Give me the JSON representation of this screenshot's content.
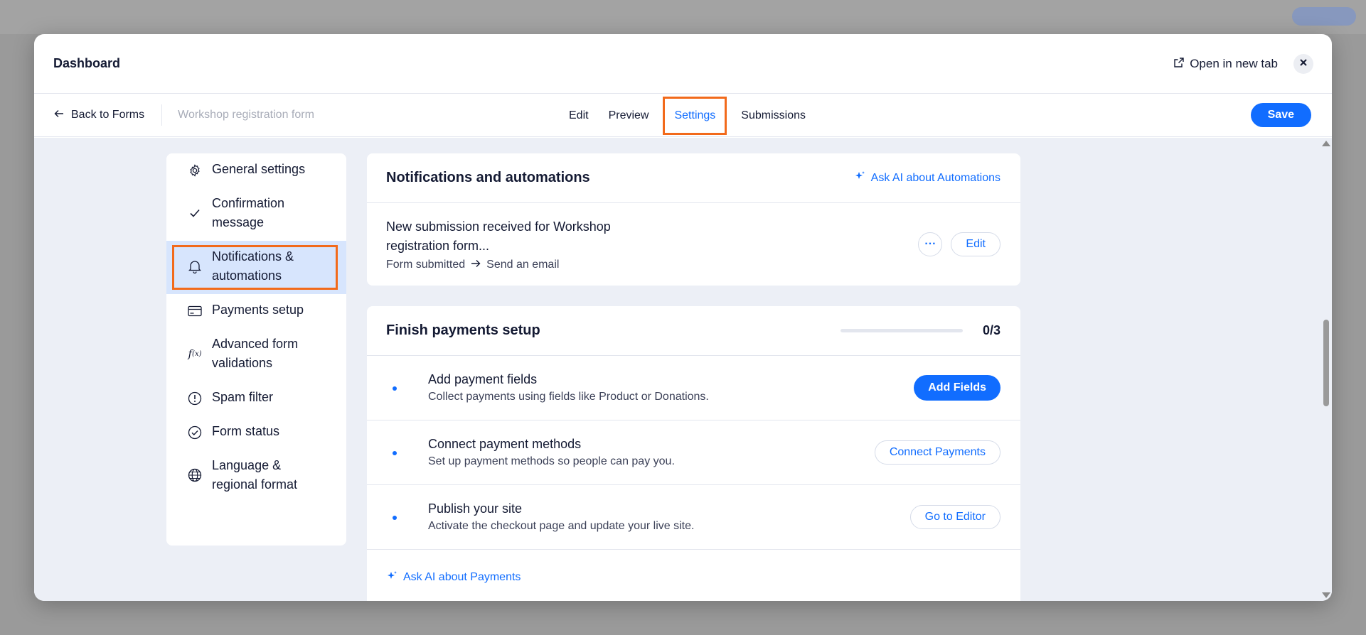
{
  "modal": {
    "title": "Dashboard",
    "open_new_tab": "Open in new tab"
  },
  "toolbar": {
    "back_label": "Back to Forms",
    "form_name": "Workshop registration form",
    "tabs": [
      "Edit",
      "Preview",
      "Settings",
      "Submissions"
    ],
    "active_tab": "Settings",
    "save_label": "Save"
  },
  "sidebar": {
    "items": [
      {
        "label": "General settings",
        "icon": "gear-icon"
      },
      {
        "label": "Confirmation message",
        "icon": "check-icon"
      },
      {
        "label": "Notifications & automations",
        "icon": "bell-icon"
      },
      {
        "label": "Payments setup",
        "icon": "credit-card-icon"
      },
      {
        "label": "Advanced form validations",
        "icon": "function-icon"
      },
      {
        "label": "Spam filter",
        "icon": "exclamation-circle-icon"
      },
      {
        "label": "Form status",
        "icon": "check-circle-icon"
      },
      {
        "label": "Language & regional format",
        "icon": "globe-icon"
      }
    ],
    "active_index": 2
  },
  "notifications_card": {
    "title": "Notifications and automations",
    "ai_link": "Ask AI about Automations",
    "automation": {
      "title": "New submission received for Workshop registration form...",
      "trigger": "Form submitted",
      "action": "Send an email",
      "more_label": "···",
      "edit_label": "Edit"
    }
  },
  "payments_card": {
    "title": "Finish payments setup",
    "progress_text": "0/3",
    "progress_fraction": 0,
    "steps": [
      {
        "title": "Add payment fields",
        "desc": "Collect payments using fields like Product or Donations.",
        "button": "Add Fields"
      },
      {
        "title": "Connect payment methods",
        "desc": "Set up payment methods so people can pay you.",
        "button": "Connect Payments"
      },
      {
        "title": "Publish your site",
        "desc": "Activate the checkout page and update your live site.",
        "button": "Go to Editor"
      }
    ],
    "ai_link": "Ask AI about Payments"
  },
  "colors": {
    "accent": "#116dff",
    "highlight_outline": "#f26a1b",
    "active_item_bg": "#d7e5fd",
    "content_bg": "#eceff6"
  }
}
